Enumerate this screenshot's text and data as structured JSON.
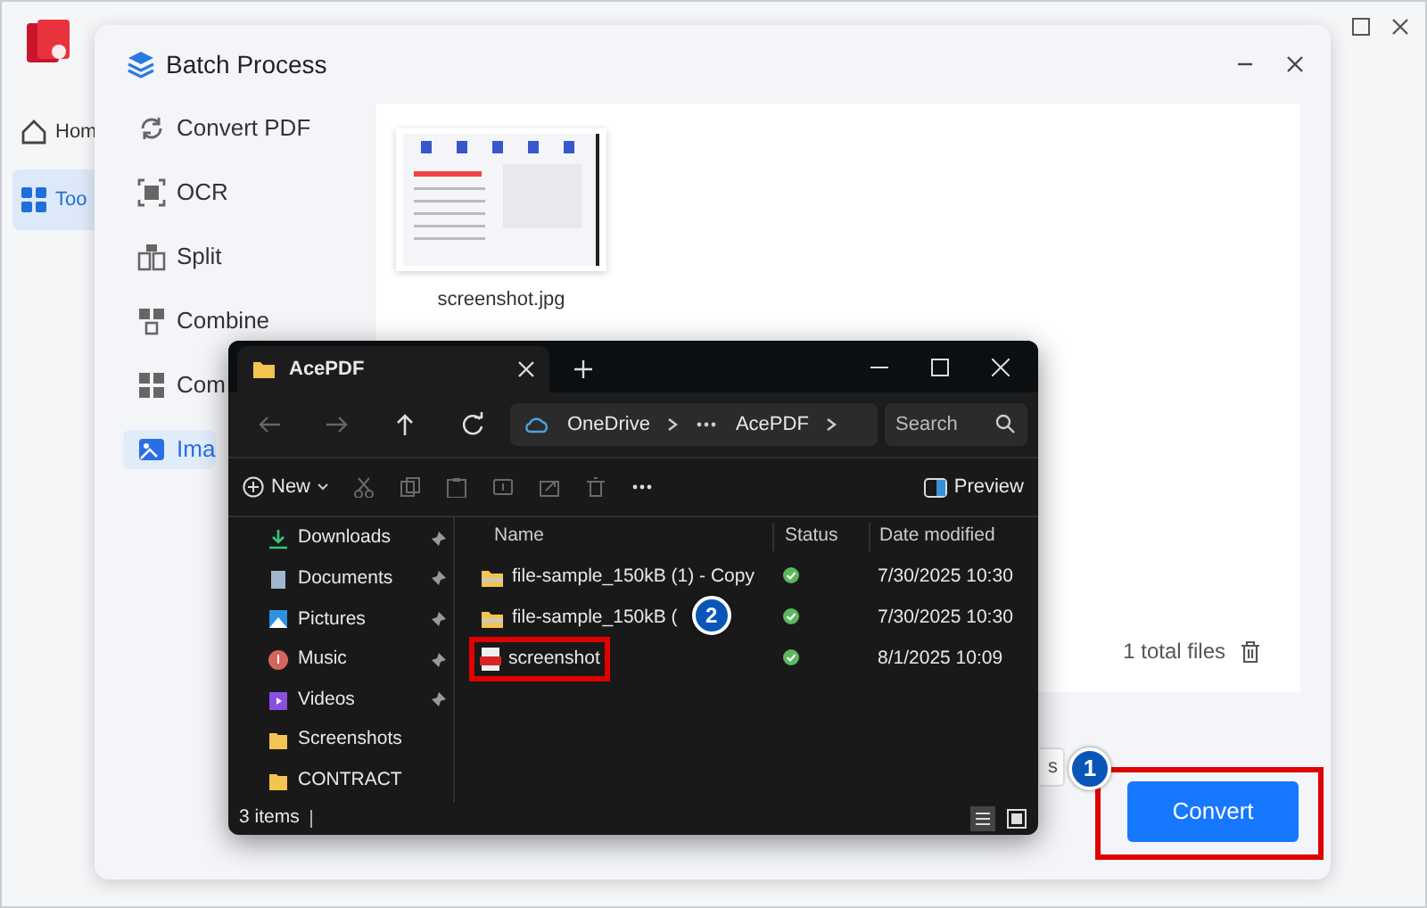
{
  "app": {
    "sidebar": [
      {
        "label": "Hom",
        "selected": false
      },
      {
        "label": "Too",
        "selected": true
      }
    ]
  },
  "batch_dialog": {
    "title": "Batch Process",
    "menu": [
      {
        "label": "Convert PDF",
        "selected": false
      },
      {
        "label": "OCR",
        "selected": false
      },
      {
        "label": "Split",
        "selected": false
      },
      {
        "label": "Combine",
        "selected": false
      },
      {
        "label": "Com",
        "selected": false
      },
      {
        "label": "Ima",
        "selected": true
      }
    ],
    "files": [
      {
        "name": "screenshot.jpg"
      }
    ],
    "total_files": "1 total files",
    "partial_button": "s",
    "convert_button": {
      "label": "Convert",
      "marked": true
    },
    "callout": "1"
  },
  "explorer": {
    "tab": "AcePDF",
    "breadcrumb": [
      "OneDrive",
      "AcePDF"
    ],
    "search": {
      "placeholder": "Search"
    },
    "new_button": "New",
    "preview_button": "Preview",
    "nav": [
      {
        "label": "Downloads",
        "pinned": true
      },
      {
        "label": "Documents",
        "pinned": true
      },
      {
        "label": "Pictures",
        "pinned": true
      },
      {
        "label": "Music",
        "pinned": true
      },
      {
        "label": "Videos",
        "pinned": true
      },
      {
        "label": "Screenshots",
        "pinned": false
      },
      {
        "label": "CONTRACT",
        "pinned": false
      }
    ],
    "columns": [
      "Name",
      "Status",
      "Date modified"
    ],
    "rows": [
      {
        "kind": "folder",
        "name": "file-sample_150kB (1) - Copy",
        "synced": true,
        "date": "7/30/2025 10:30",
        "marked": false
      },
      {
        "kind": "folder",
        "name": "file-sample_150kB (",
        "synced": true,
        "date": "7/30/2025 10:30",
        "marked": false
      },
      {
        "kind": "pdf",
        "name": "screenshot",
        "synced": true,
        "date": "8/1/2025 10:09",
        "marked": true
      }
    ],
    "status_text": "3 items",
    "callout": "2"
  }
}
